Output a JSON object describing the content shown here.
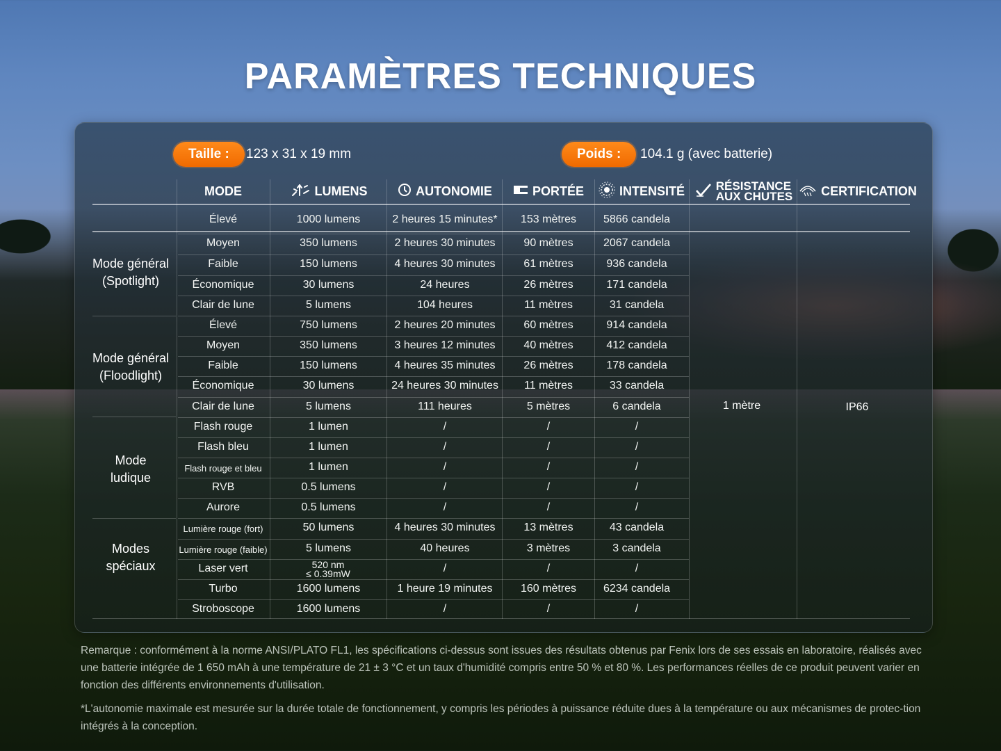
{
  "title": "PARAMÈTRES TECHNIQUES",
  "specs": {
    "size_label": "Taille :",
    "size_value": "123 x 31 x 19 mm",
    "weight_label": "Poids :",
    "weight_value": "104.1 g (avec batterie)"
  },
  "headers": {
    "mode": "MODE",
    "lumens": "LUMENS",
    "runtime": "AUTONOMIE",
    "distance": "PORTÉE",
    "intensity": "INTENSITÉ",
    "impact_line1": "RÉSISTANCE",
    "impact_line2": "AUX CHUTES",
    "certification": "CERTIFICATION"
  },
  "icons": {
    "lumens": "light-rays-icon",
    "runtime": "clock-icon",
    "distance": "beam-distance-icon",
    "intensity": "sun-target-icon",
    "impact": "drop-check-icon",
    "certification": "water-drops-icon"
  },
  "groups": {
    "spotlight_line1": "Mode général",
    "spotlight_line2": "(Spotlight)",
    "floodlight_line1": "Mode général",
    "floodlight_line2": "(Floodlight)",
    "fun_line1": "Mode",
    "fun_line2": "ludique",
    "special_line1": "Modes",
    "special_line2": "spéciaux"
  },
  "rows": [
    {
      "mode": "Élevé",
      "lumens": "1000 lumens",
      "runtime": "2 heures 15 minutes*",
      "distance": "153 mètres",
      "intensity": "5866 candela"
    },
    {
      "mode": "Moyen",
      "lumens": "350 lumens",
      "runtime": "2 heures 30 minutes",
      "distance": "90 mètres",
      "intensity": "2067 candela"
    },
    {
      "mode": "Faible",
      "lumens": "150 lumens",
      "runtime": "4 heures 30 minutes",
      "distance": "61 mètres",
      "intensity": "936 candela"
    },
    {
      "mode": "Économique",
      "lumens": "30 lumens",
      "runtime": "24 heures",
      "distance": "26 mètres",
      "intensity": "171 candela"
    },
    {
      "mode": "Clair de lune",
      "lumens": "5 lumens",
      "runtime": "104 heures",
      "distance": "11 mètres",
      "intensity": "31 candela"
    },
    {
      "mode": "Élevé",
      "lumens": "750 lumens",
      "runtime": "2 heures 20 minutes",
      "distance": "60 mètres",
      "intensity": "914 candela"
    },
    {
      "mode": "Moyen",
      "lumens": "350 lumens",
      "runtime": "3 heures 12 minutes",
      "distance": "40 mètres",
      "intensity": "412 candela"
    },
    {
      "mode": "Faible",
      "lumens": "150 lumens",
      "runtime": "4 heures 35 minutes",
      "distance": "26 mètres",
      "intensity": "178 candela"
    },
    {
      "mode": "Économique",
      "lumens": "30 lumens",
      "runtime": "24 heures 30 minutes",
      "distance": "11 mètres",
      "intensity": "33 candela"
    },
    {
      "mode": "Clair de lune",
      "lumens": "5 lumens",
      "runtime": "111 heures",
      "distance": "5 mètres",
      "intensity": "6 candela"
    },
    {
      "mode": "Flash rouge",
      "lumens": "1 lumen",
      "runtime": "/",
      "distance": "/",
      "intensity": "/"
    },
    {
      "mode": "Flash bleu",
      "lumens": "1 lumen",
      "runtime": "/",
      "distance": "/",
      "intensity": "/"
    },
    {
      "mode": "Flash rouge et bleu",
      "lumens": "1 lumen",
      "runtime": "/",
      "distance": "/",
      "intensity": "/"
    },
    {
      "mode": "RVB",
      "lumens": "0.5 lumens",
      "runtime": "/",
      "distance": "/",
      "intensity": "/"
    },
    {
      "mode": "Aurore",
      "lumens": "0.5 lumens",
      "runtime": "/",
      "distance": "/",
      "intensity": "/"
    },
    {
      "mode": "Lumière rouge (fort)",
      "lumens": "50 lumens",
      "runtime": "4 heures 30 minutes",
      "distance": "13 mètres",
      "intensity": "43 candela"
    },
    {
      "mode": "Lumière rouge (faible)",
      "lumens": "5 lumens",
      "runtime": "40 heures",
      "distance": "3 mètres",
      "intensity": "3 candela"
    },
    {
      "mode": "Laser vert",
      "lumens_line1": "520 nm",
      "lumens_line2": "≤ 0.39mW",
      "runtime": "/",
      "distance": "/",
      "intensity": "/"
    },
    {
      "mode": "Turbo",
      "lumens": "1600 lumens",
      "runtime": "1 heure 19 minutes",
      "distance": "160 mètres",
      "intensity": "6234 candela"
    },
    {
      "mode": "Stroboscope",
      "lumens": "1600 lumens",
      "runtime": "/",
      "distance": "/",
      "intensity": "/"
    }
  ],
  "impact_value": "1 mètre",
  "certification_value": "IP66",
  "notes": {
    "remark": "Remarque : conformément à la norme ANSI/PLATO FL1, les spécifications ci-dessus sont issues des résultats obtenus par Fenix lors de ses essais en laboratoire, réalisés avec une batterie intégrée de 1 650 mAh à une température de 21 ± 3 °C et un taux d'humidité compris entre 50 % et 80 %. Les performances réelles de ce produit peuvent varier en fonction des différents environnements d'utilisation.",
    "footnote": "*L'autonomie maximale est mesurée sur la durée totale de fonctionnement, y compris les périodes à puissance réduite dues à la température ou aux mécanismes de protec-tion intégrés à la conception."
  }
}
